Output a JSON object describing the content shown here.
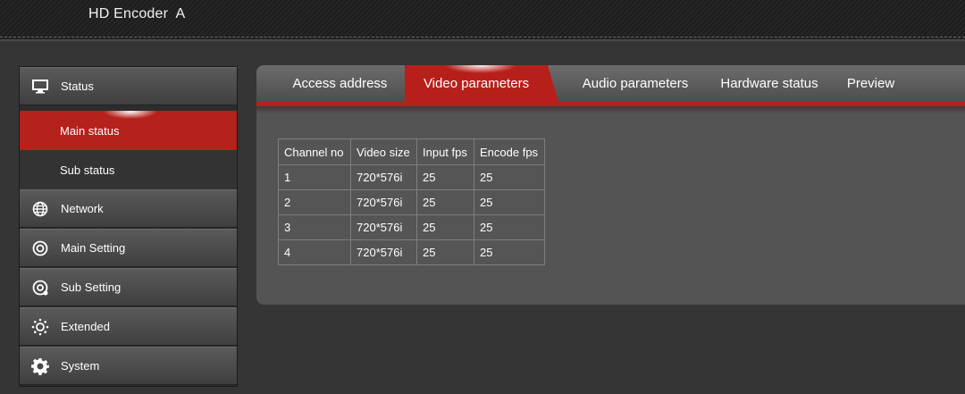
{
  "header": {
    "title": "HD Encoder  A"
  },
  "sidebar": {
    "items": [
      {
        "label": "Status",
        "icon": "monitor-icon"
      },
      {
        "label": "Main status",
        "active": true
      },
      {
        "label": "Sub status"
      },
      {
        "label": "Network",
        "icon": "globe-icon"
      },
      {
        "label": "Main Setting",
        "icon": "target-icon"
      },
      {
        "label": "Sub Setting",
        "icon": "target-settings-icon"
      },
      {
        "label": "Extended",
        "icon": "sun-gear-icon"
      },
      {
        "label": "System",
        "icon": "gear-icon"
      }
    ]
  },
  "tabs": [
    {
      "label": "Access address"
    },
    {
      "label": "Video parameters",
      "active": true
    },
    {
      "label": "Audio parameters"
    },
    {
      "label": "Hardware status"
    },
    {
      "label": "Preview"
    }
  ],
  "table": {
    "columns": [
      "Channel no",
      "Video size",
      "Input fps",
      "Encode fps"
    ],
    "rows": [
      [
        "1",
        "720*576i",
        "25",
        "25"
      ],
      [
        "2",
        "720*576i",
        "25",
        "25"
      ],
      [
        "3",
        "720*576i",
        "25",
        "25"
      ],
      [
        "4",
        "720*576i",
        "25",
        "25"
      ]
    ]
  },
  "colors": {
    "accent": "#b7201a",
    "background": "#353535",
    "panel": "#545454"
  }
}
